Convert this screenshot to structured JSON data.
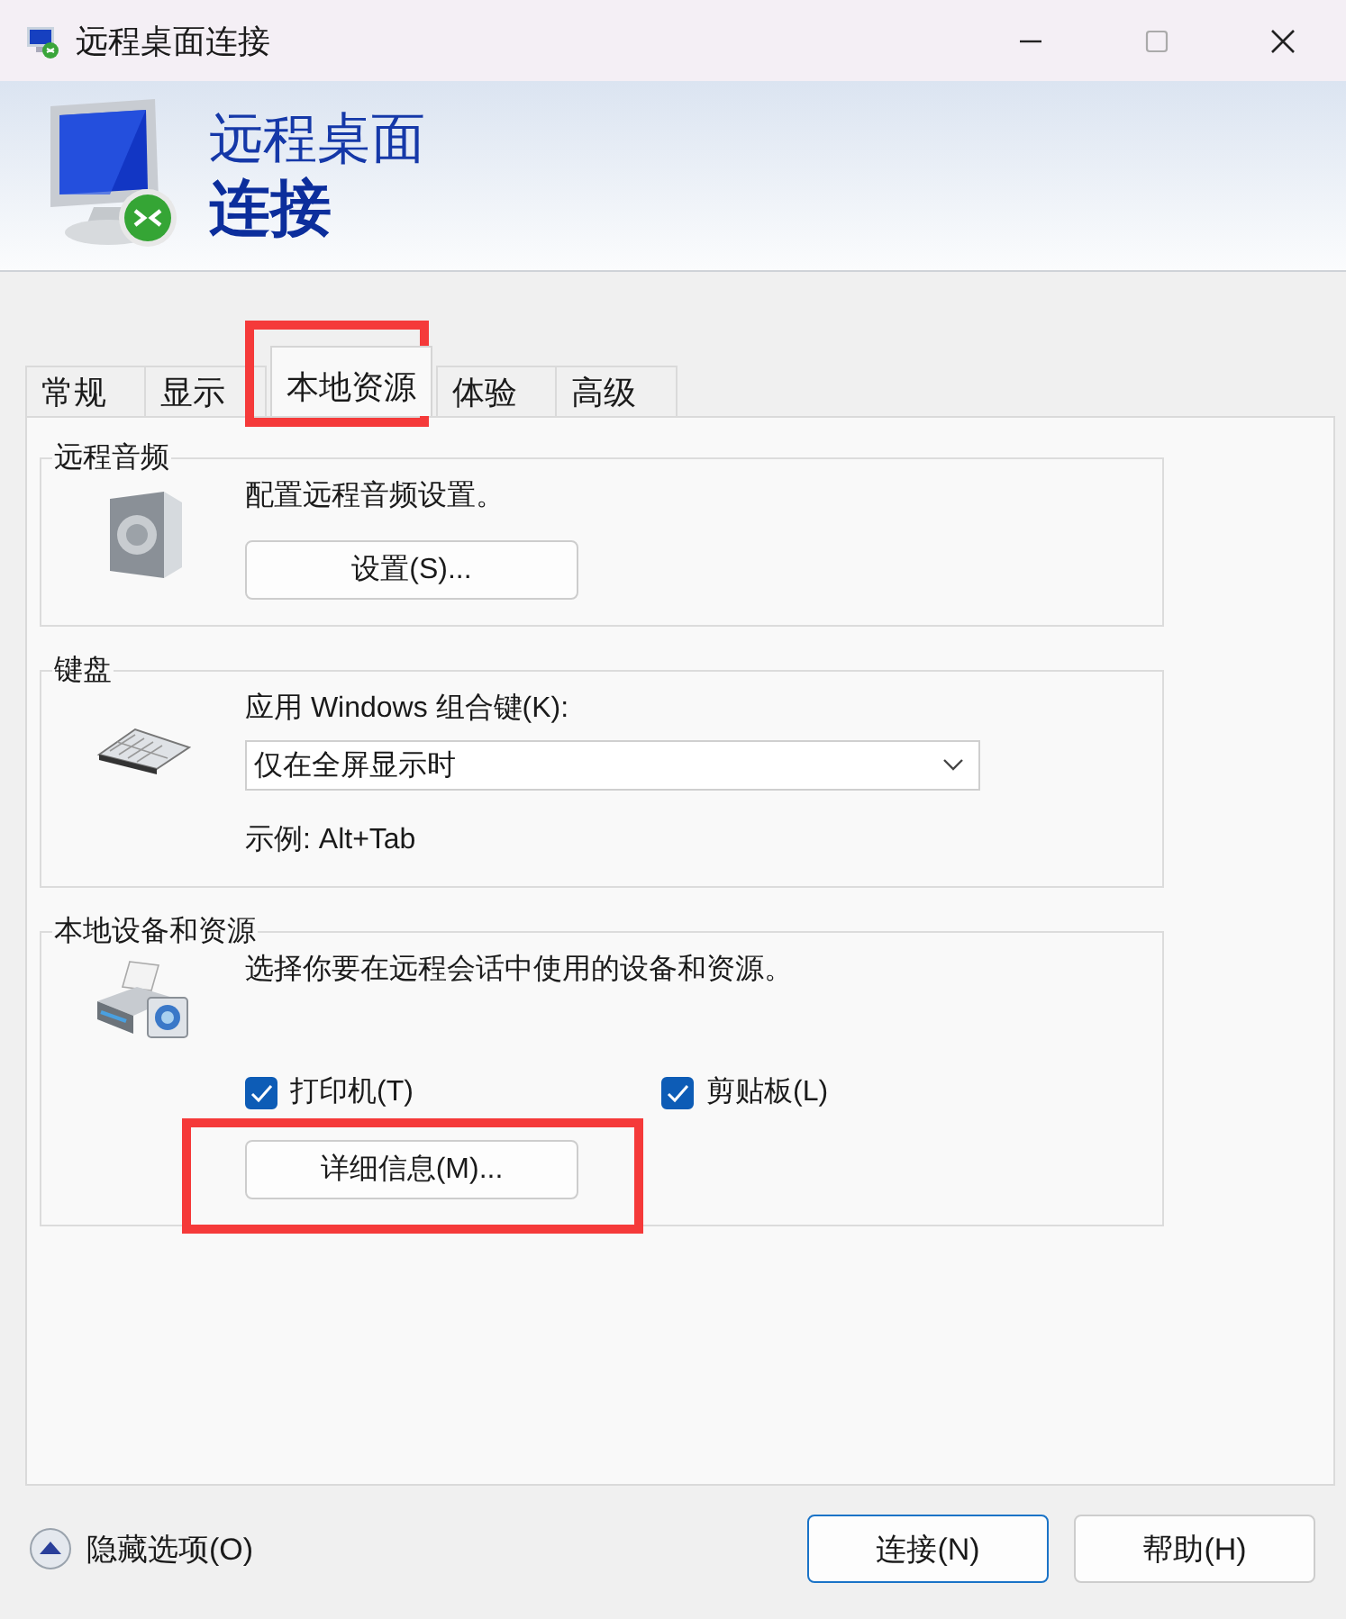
{
  "window": {
    "title": "远程桌面连接"
  },
  "banner": {
    "line_1": "远程桌面",
    "line_2": "连接"
  },
  "tabs": [
    {
      "label": "常规",
      "selected": false,
      "highlighted": false
    },
    {
      "label": "显示",
      "selected": false,
      "highlighted": false
    },
    {
      "label": "本地资源",
      "selected": true,
      "highlighted": true
    },
    {
      "label": "体验",
      "selected": false,
      "highlighted": false
    },
    {
      "label": "高级",
      "selected": false,
      "highlighted": false
    }
  ],
  "groups": [
    {
      "kind": "audio",
      "title": "远程音频",
      "description": "配置远程音频设置。",
      "button": {
        "label": "设置(S)...",
        "highlighted": false
      }
    },
    {
      "kind": "keyboard",
      "title": "键盘",
      "field_label": "应用 Windows 组合键(K):",
      "dropdown": {
        "value": "仅在全屏显示时"
      },
      "example": "示例: Alt+Tab"
    },
    {
      "kind": "devices",
      "title": "本地设备和资源",
      "description": "选择你要在远程会话中使用的设备和资源。",
      "checkboxes": [
        {
          "label": "打印机(T)",
          "checked": true
        },
        {
          "label": "剪贴板(L)",
          "checked": true
        }
      ],
      "button": {
        "label": "详细信息(M)...",
        "highlighted": true
      }
    }
  ],
  "footer": {
    "toggle": "隐藏选项(O)",
    "buttons": [
      {
        "label": "连接(N)",
        "default": true
      },
      {
        "label": "帮助(H)",
        "default": false
      }
    ]
  }
}
